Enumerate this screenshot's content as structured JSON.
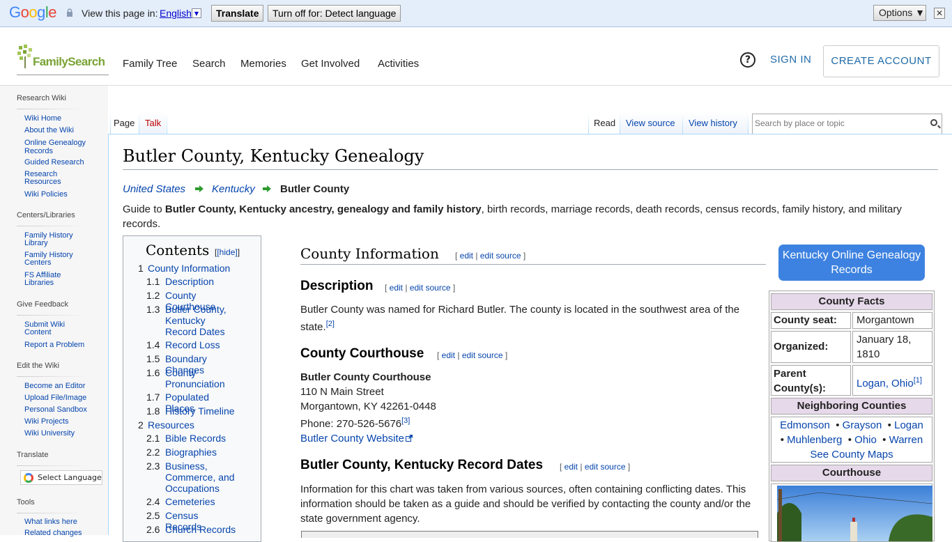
{
  "translate_bar": {
    "logo": "Google",
    "view_text": "View this page in:",
    "language": "English",
    "translate_btn": "Translate",
    "turnoff_btn": "Turn off for: Detect language",
    "options_btn": "Options ▼",
    "close": "✕"
  },
  "header": {
    "logo_text": "FamilySearch",
    "nav": [
      "Family Tree",
      "Search",
      "Memories",
      "Get Involved",
      "Activities"
    ],
    "help": "?",
    "sign_in": "SIGN IN",
    "create_account": "CREATE ACCOUNT"
  },
  "sidebar": {
    "research_wiki": "Research Wiki",
    "wiki_items": [
      "Wiki Home",
      "About the Wiki",
      "Online Genealogy Records",
      "Guided Research",
      "Research Resources",
      "Wiki Policies"
    ],
    "centers": "Centers/Libraries",
    "center_items": [
      "Family History Library",
      "Family History Centers",
      "FS Affiliate Libraries"
    ],
    "feedback": "Give Feedback",
    "feedback_items": [
      "Submit Wiki Content",
      "Report a Problem"
    ],
    "edit": "Edit the Wiki",
    "edit_items": [
      "Become an Editor",
      "Upload File/Image",
      "Personal Sandbox",
      "Wiki Projects",
      "Wiki University"
    ],
    "translate": "Translate",
    "select_language": "Select Language",
    "tools": "Tools",
    "tools_items": [
      "What links here",
      "Related changes"
    ]
  },
  "tabs": {
    "page": "Page",
    "talk": "Talk",
    "read": "Read",
    "view_source": "View source",
    "view_history": "View history",
    "search_placeholder": "Search by place or topic"
  },
  "article": {
    "title": "Butler County, Kentucky Genealogy",
    "crumb1": "United States",
    "crumb2": "Kentucky",
    "crumb3": "Butler County",
    "intro_a": "Guide to ",
    "intro_b": "Butler County, Kentucky ancestry, genealogy and family history",
    "intro_c": ", birth records, marriage records, death records, census records, family history, and military records.",
    "h_county_info": "County Information",
    "h_description": "Description",
    "description": "Butler County was named for Richard Butler. The county is located in the southwest area of the state.",
    "ref2": "[2]",
    "h_courthouse": "County Courthouse",
    "courthouse_name": "Butler County Courthouse",
    "address1": "110 N Main Street",
    "address2": "Morgantown, KY 42261-0448",
    "phone": "Phone: 270-526-5676",
    "ref3": "[3]",
    "website": "Butler County Website",
    "h_record_dates": "Butler County, Kentucky Record Dates",
    "record_dates_text": "Information for this chart was taken from various sources, often containing conflicting dates. This information should be taken as a guide and should be verified by contacting the county and/or the state government agency.",
    "edit": "edit",
    "edit_source": "edit source"
  },
  "toc": {
    "title": "Contents",
    "hide": "[hide]",
    "items": [
      {
        "n": "1",
        "t": "County Information"
      },
      {
        "n": "1.1",
        "t": "Description"
      },
      {
        "n": "1.2",
        "t": "County Courthouse"
      },
      {
        "n": "1.3",
        "t": "Butler County, Kentucky Record Dates"
      },
      {
        "n": "1.4",
        "t": "Record Loss"
      },
      {
        "n": "1.5",
        "t": "Boundary Changes"
      },
      {
        "n": "1.6",
        "t": "County Pronunciation"
      },
      {
        "n": "1.7",
        "t": "Populated Places"
      },
      {
        "n": "1.8",
        "t": "History Timeline"
      },
      {
        "n": "2",
        "t": "Resources"
      },
      {
        "n": "2.1",
        "t": "Bible Records"
      },
      {
        "n": "2.2",
        "t": "Biographies"
      },
      {
        "n": "2.3",
        "t": "Business, Commerce, and Occupations"
      },
      {
        "n": "2.4",
        "t": "Cemeteries"
      },
      {
        "n": "2.5",
        "t": "Census Records"
      },
      {
        "n": "2.6",
        "t": "Church Records"
      }
    ]
  },
  "infobox": {
    "button": "Kentucky Online Genealogy Records",
    "facts": "County Facts",
    "seat_label": "County seat:",
    "seat": "Morgantown",
    "organized_label": "Organized:",
    "organized": "January 18, 1810",
    "parent_label": "Parent County(s):",
    "parent": "Logan, Ohio",
    "ref1": "[1]",
    "neighbors": "Neighboring Counties",
    "n1": "Edmonson",
    "n2": "Grayson",
    "n3": "Logan",
    "n4": "Muhlenberg",
    "n5": "Ohio",
    "n6": "Warren",
    "maps": "See County Maps",
    "courthouse": "Courthouse"
  }
}
